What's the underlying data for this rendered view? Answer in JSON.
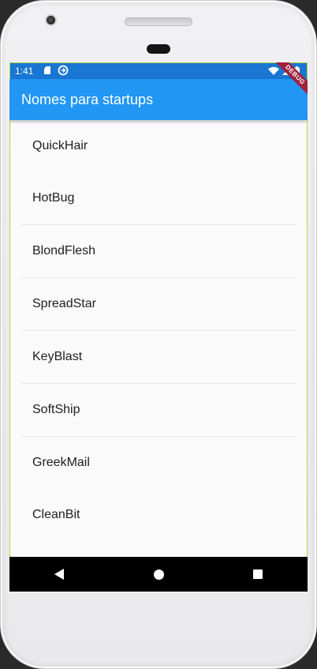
{
  "status_bar": {
    "time": "1:41",
    "icons": [
      "sd-card-icon",
      "sync-icon",
      "wifi-icon",
      "signal-icon",
      "battery-icon"
    ]
  },
  "app_bar": {
    "title": "Nomes para startups",
    "color": "#2196f3"
  },
  "debug_banner": {
    "label": "DEBUG"
  },
  "list": {
    "items": [
      "QuickHair",
      "HotBug",
      "BlondFlesh",
      "SpreadStar",
      "KeyBlast",
      "SoftShip",
      "GreekMail",
      "CleanBit"
    ]
  },
  "nav_bar": {
    "buttons": [
      "back-icon",
      "home-icon",
      "recents-icon"
    ]
  },
  "colors": {
    "status_bar": "#1976d2",
    "app_bar": "#2196f3",
    "background": "#fafafa",
    "debug_banner": "#a0223d"
  }
}
